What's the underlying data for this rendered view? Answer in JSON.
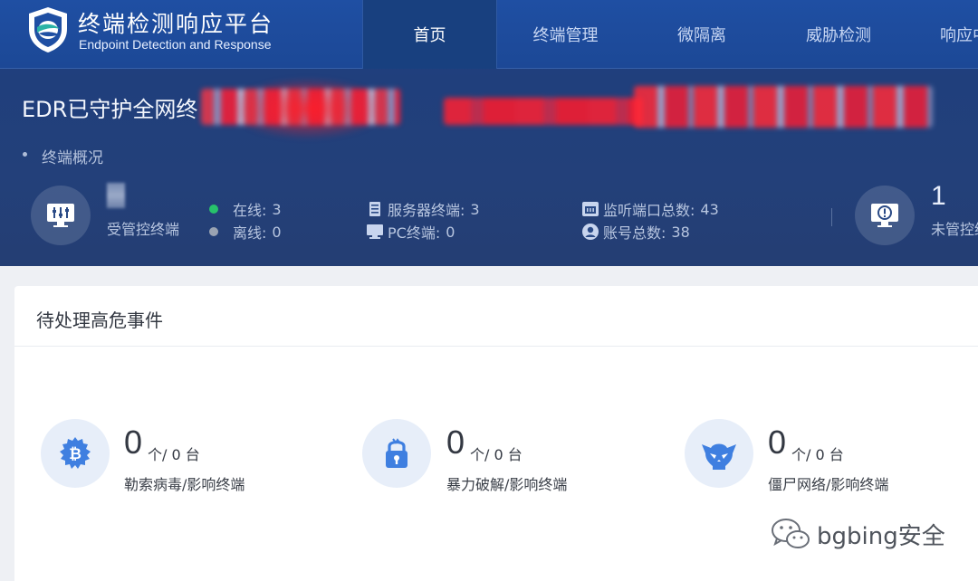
{
  "header": {
    "brand_title": "终端检测响应平台",
    "brand_subtitle": "Endpoint Detection and Response",
    "nav": [
      {
        "label": "首页",
        "active": true
      },
      {
        "label": "终端管理",
        "active": false
      },
      {
        "label": "微隔离",
        "active": false
      },
      {
        "label": "威胁检测",
        "active": false
      },
      {
        "label": "响应中",
        "active": false
      }
    ]
  },
  "banner": {
    "text": "EDR已守护全网终",
    "section_label": "终端概况"
  },
  "overview": {
    "managed_label": "受管控终端",
    "online_label": "在线:",
    "online_value": "3",
    "offline_label": "离线:",
    "offline_value": "0",
    "server_label": "服务器终端:",
    "server_value": "3",
    "pc_label": "PC终端:",
    "pc_value": "0",
    "ports_label": "监听端口总数:",
    "ports_value": "43",
    "accounts_label": "账号总数:",
    "accounts_value": "38",
    "unmanaged_count": "1",
    "unmanaged_label": "未管控终"
  },
  "events": {
    "title": "待处理高危事件",
    "items": [
      {
        "icon": "bitcoin-icon",
        "count": "0",
        "unit": "个/ 0 台",
        "label": "勒索病毒/影响终端"
      },
      {
        "icon": "lock-icon",
        "count": "0",
        "unit": "个/ 0 台",
        "label": "暴力破解/影响终端"
      },
      {
        "icon": "skull-icon",
        "count": "0",
        "unit": "个/ 0 台",
        "label": "僵尸网络/影响终端"
      }
    ]
  },
  "watermark": {
    "text": "bgbing安全"
  },
  "colors": {
    "online": "#27c26b",
    "offline": "#9aa3b2",
    "accent_icon": "#3f7fe0"
  }
}
